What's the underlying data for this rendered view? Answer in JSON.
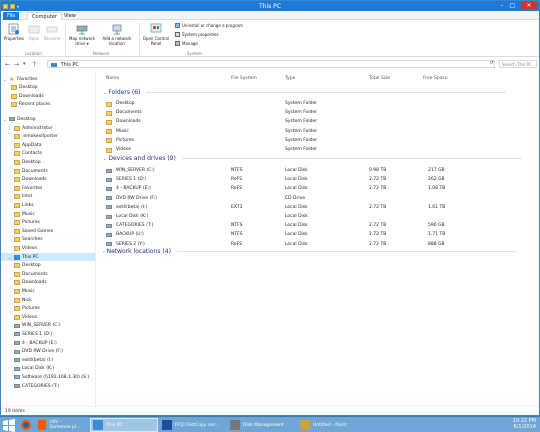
{
  "window": {
    "title": "This PC"
  },
  "window_controls": {
    "minimize": "–",
    "maximize": "□",
    "close": "✕"
  },
  "tabs": {
    "file": "File",
    "computer": "Computer",
    "view": "View"
  },
  "ribbon": {
    "properties": "Properties",
    "open": "Open",
    "rename": "Rename",
    "location_label": "Location",
    "map_drive": "Map network drive ▾",
    "add_location": "Add a network location",
    "network_label": "Network",
    "control_panel": "Open Control Panel",
    "uninstall": "Uninstall or change a program",
    "system_props": "System properties",
    "manage": "Manage",
    "system_label": "System"
  },
  "address": {
    "path": "This PC",
    "search_placeholder": "Search This PC",
    "nav_back": "←",
    "nav_fwd": "→",
    "nav_down": "▾",
    "nav_up": "↑",
    "refresh": "⟳"
  },
  "nav_pane": {
    "favorites": "Favorites",
    "fav_items": [
      "Desktop",
      "Downloads",
      "Recent places"
    ],
    "desktop": "Desktop",
    "administrator": "Administrator",
    "admin_items": [
      ".emokexifporter",
      "AppData",
      "Contacts",
      "Desktop",
      "Documents",
      "Downloads",
      "Favorites",
      "Intel",
      "Links",
      "Music",
      "Pictures",
      "Saved Games",
      "Searches",
      "Videos"
    ],
    "this_pc": "This PC",
    "pc_items": [
      "Desktop",
      "Documents",
      "Downloads",
      "Music",
      "Nick",
      "Pictures",
      "Videos",
      "WIN_SERVER (C:)",
      "SERIES 1 (D:)",
      "4 - BACKUP (E:)",
      "DVD RW Drive (F:)",
      "ext4(beta) (I:)",
      "Local Disk (K:)",
      "Software (\\\\192.168.1.30) (S:)",
      "CATEGORIES (T:)"
    ]
  },
  "columns": {
    "name": "Name",
    "fs": "File System",
    "type": "Type",
    "total": "Total Size",
    "free": "Free Space"
  },
  "groups": {
    "folders": "Folders (6)",
    "devices": "Devices and drives (9)",
    "network": "Network locations (4)"
  },
  "folders": [
    {
      "name": "Desktop",
      "type": "System Folder"
    },
    {
      "name": "Documents",
      "type": "System Folder"
    },
    {
      "name": "Downloads",
      "type": "System Folder"
    },
    {
      "name": "Music",
      "type": "System Folder"
    },
    {
      "name": "Pictures",
      "type": "System Folder"
    },
    {
      "name": "Videos",
      "type": "System Folder"
    }
  ],
  "drives": [
    {
      "name": "WIN_SERVER (C:)",
      "fs": "NTFS",
      "type": "Local Disk",
      "total": "0.98 TB",
      "free": "217 GB"
    },
    {
      "name": "SERIES 1 (D:)",
      "fs": "ReFS",
      "type": "Local Disk",
      "total": "2.72 TB",
      "free": "262 GB"
    },
    {
      "name": "4 - BACKUP (E:)",
      "fs": "ReFS",
      "type": "Local Disk",
      "total": "2.72 TB",
      "free": "1.08 TB"
    },
    {
      "name": "DVD RW Drive (F:)",
      "fs": "",
      "type": "CD Drive",
      "total": "",
      "free": ""
    },
    {
      "name": "ext4(beta) (I:)",
      "fs": "EXT3",
      "type": "Local Disk",
      "total": "2.72 TB",
      "free": "1.61 TB"
    },
    {
      "name": "Local Disk (K:)",
      "fs": "",
      "type": "Local Disk",
      "total": "",
      "free": ""
    },
    {
      "name": "CATEGORIES (T:)",
      "fs": "NTFS",
      "type": "Local Disk",
      "total": "2.72 TB",
      "free": "590 GB"
    },
    {
      "name": "BACKUP (U:)",
      "fs": "NTFS",
      "type": "Local Disk",
      "total": "1.72 TB",
      "free": "1.71 TB"
    },
    {
      "name": "SERIES 2 (Y:)",
      "fs": "ReFS",
      "type": "Local Disk",
      "total": "2.72 TB",
      "free": "888 GB"
    }
  ],
  "status": {
    "items": "19 items"
  },
  "taskbar": {
    "buttons": [
      "rdfs - Someone.pl...",
      "This PC",
      "[FQ] FastCopy ver...",
      "Disk Management",
      "Untitled - Paint"
    ],
    "time": "10:22 PM",
    "date": "6/1/2014"
  },
  "colors": {
    "accent": "#1c7bd8",
    "folder": "#f3d069",
    "selected": "#cde8ff",
    "group": "#1e3287"
  }
}
